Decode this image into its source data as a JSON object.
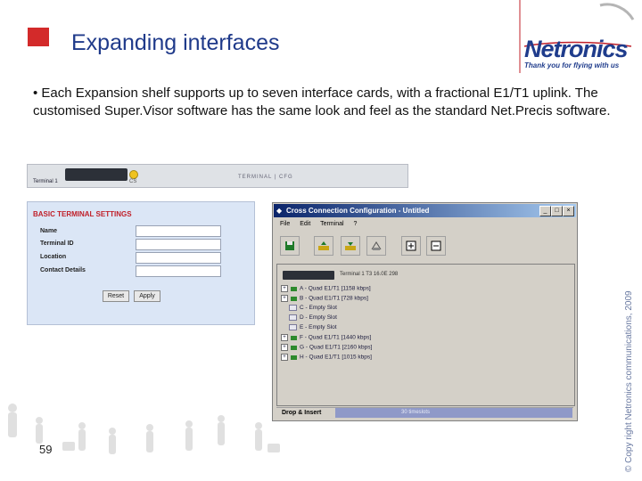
{
  "slide": {
    "title": "Expanding interfaces",
    "body": "• Each Expansion shelf supports up to seven interface cards, with a fractional E1/T1 uplink. The customised Super.Visor software has the same look and feel as the standard Net.Precis software.",
    "slide_number": "59",
    "copyright": "© Copy right Netronics communications, 2009"
  },
  "logo": {
    "name": "Netronics",
    "tagline": "Thank you for flying with us"
  },
  "strip": {
    "device_label": "Terminal 1",
    "cs_label": "CS",
    "right_label": "TERMINAL | CFG"
  },
  "basic_terminal": {
    "title": "BASIC TERMINAL SETTINGS",
    "fields": [
      {
        "label": "Name",
        "value": ""
      },
      {
        "label": "Terminal ID",
        "value": ""
      },
      {
        "label": "Location",
        "value": ""
      },
      {
        "label": "Contact Details",
        "value": ""
      }
    ],
    "reset_label": "Reset",
    "apply_label": "Apply"
  },
  "cross_connection": {
    "title": "Cross Connection Configuration - Untitled",
    "menu": [
      "File",
      "Edit",
      "Terminal",
      "?"
    ],
    "window_buttons": [
      "_",
      "□",
      "×"
    ],
    "device_text": "Terminal 1 T3 16.0E 298",
    "tree": [
      {
        "expander": "+",
        "text": "A - Quad E1/T1 [1158 kbps]",
        "empty": false
      },
      {
        "expander": "+",
        "text": "B - Quad E1/T1 [728 kbps]",
        "empty": false
      },
      {
        "expander": "",
        "text": "C - Empty Slot",
        "empty": true
      },
      {
        "expander": "",
        "text": "D - Empty Slot",
        "empty": true
      },
      {
        "expander": "",
        "text": "E - Empty Slot",
        "empty": true
      },
      {
        "expander": "+",
        "text": "F - Quad E1/T1 [1440 kbps]",
        "empty": false
      },
      {
        "expander": "+",
        "text": "G - Quad E1/T1 [2160 kbps]",
        "empty": false
      },
      {
        "expander": "+",
        "text": "H - Quad E1/T1 [1015 kbps]",
        "empty": false
      }
    ],
    "status_label": "Drop & Insert",
    "status_text": "30 timeslots"
  },
  "colors": {
    "title_blue": "#1f3a8a",
    "accent_red": "#d32a2a",
    "panel_blue": "#dbe6f6",
    "titlebar_dark": "#0a246a",
    "status_bar": "#8f99c8"
  }
}
